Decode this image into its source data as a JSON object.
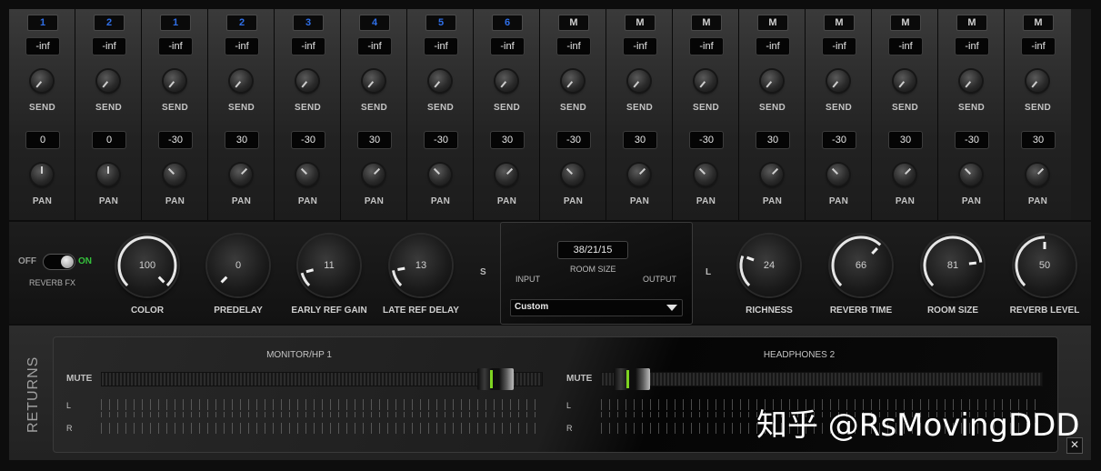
{
  "channels": [
    {
      "num": "1",
      "mono": false,
      "send": "-inf",
      "send_label": "SEND",
      "pan": "0",
      "pan_label": "PAN",
      "pan_rot": 0
    },
    {
      "num": "2",
      "mono": false,
      "send": "-inf",
      "send_label": "SEND",
      "pan": "0",
      "pan_label": "PAN",
      "pan_rot": 0
    },
    {
      "num": "1",
      "mono": false,
      "send": "-inf",
      "send_label": "SEND",
      "pan": "-30",
      "pan_label": "PAN",
      "pan_rot": -45
    },
    {
      "num": "2",
      "mono": false,
      "send": "-inf",
      "send_label": "SEND",
      "pan": "30",
      "pan_label": "PAN",
      "pan_rot": 45
    },
    {
      "num": "3",
      "mono": false,
      "send": "-inf",
      "send_label": "SEND",
      "pan": "-30",
      "pan_label": "PAN",
      "pan_rot": -45
    },
    {
      "num": "4",
      "mono": false,
      "send": "-inf",
      "send_label": "SEND",
      "pan": "30",
      "pan_label": "PAN",
      "pan_rot": 45
    },
    {
      "num": "5",
      "mono": false,
      "send": "-inf",
      "send_label": "SEND",
      "pan": "-30",
      "pan_label": "PAN",
      "pan_rot": -45
    },
    {
      "num": "6",
      "mono": false,
      "send": "-inf",
      "send_label": "SEND",
      "pan": "30",
      "pan_label": "PAN",
      "pan_rot": 45
    },
    {
      "num": "M",
      "mono": true,
      "send": "-inf",
      "send_label": "SEND",
      "pan": "-30",
      "pan_label": "PAN",
      "pan_rot": -45
    },
    {
      "num": "M",
      "mono": true,
      "send": "-inf",
      "send_label": "SEND",
      "pan": "30",
      "pan_label": "PAN",
      "pan_rot": 45
    },
    {
      "num": "M",
      "mono": true,
      "send": "-inf",
      "send_label": "SEND",
      "pan": "-30",
      "pan_label": "PAN",
      "pan_rot": -45
    },
    {
      "num": "M",
      "mono": true,
      "send": "-inf",
      "send_label": "SEND",
      "pan": "30",
      "pan_label": "PAN",
      "pan_rot": 45
    },
    {
      "num": "M",
      "mono": true,
      "send": "-inf",
      "send_label": "SEND",
      "pan": "-30",
      "pan_label": "PAN",
      "pan_rot": -45
    },
    {
      "num": "M",
      "mono": true,
      "send": "-inf",
      "send_label": "SEND",
      "pan": "30",
      "pan_label": "PAN",
      "pan_rot": 45
    },
    {
      "num": "M",
      "mono": true,
      "send": "-inf",
      "send_label": "SEND",
      "pan": "-30",
      "pan_label": "PAN",
      "pan_rot": -45
    },
    {
      "num": "M",
      "mono": true,
      "send": "-inf",
      "send_label": "SEND",
      "pan": "30",
      "pan_label": "PAN",
      "pan_rot": 45
    }
  ],
  "reverb": {
    "toggle_off": "OFF",
    "toggle_on": "ON",
    "toggle_label": "REVERB FX",
    "toggle_state": "on",
    "left_knobs": [
      {
        "label": "COLOR",
        "value": "100"
      },
      {
        "label": "PREDELAY",
        "value": "0"
      },
      {
        "label": "EARLY REF GAIN",
        "value": "11"
      },
      {
        "label": "LATE REF DELAY",
        "value": "13"
      }
    ],
    "s_mark": "S",
    "l_mark": "L",
    "room_panel": {
      "readout": "38/21/15",
      "room_size_label": "ROOM SIZE",
      "input_label": "INPUT",
      "output_label": "OUTPUT",
      "preset_value": "Custom"
    },
    "right_knobs": [
      {
        "label": "RICHNESS",
        "value": "24"
      },
      {
        "label": "REVERB TIME",
        "value": "66"
      },
      {
        "label": "ROOM SIZE",
        "value": "81"
      },
      {
        "label": "REVERB LEVEL",
        "value": "50"
      }
    ]
  },
  "returns": {
    "section_label": "RETURNS",
    "buses": [
      {
        "title": "MONITOR/HP 1",
        "mute_label": "MUTE",
        "l_label": "L",
        "r_label": "R",
        "fader_level": 0.93
      },
      {
        "title": "HEADPHONES 2",
        "mute_label": "MUTE",
        "l_label": "L",
        "r_label": "R",
        "fader_level": 0.03
      }
    ],
    "close_label": "✕"
  },
  "watermark": "知乎 @RsMovingDDD",
  "colors": {
    "accent_green": "#7ed321",
    "channel_blue": "#2f6fe8",
    "on_green": "#35c23c"
  }
}
